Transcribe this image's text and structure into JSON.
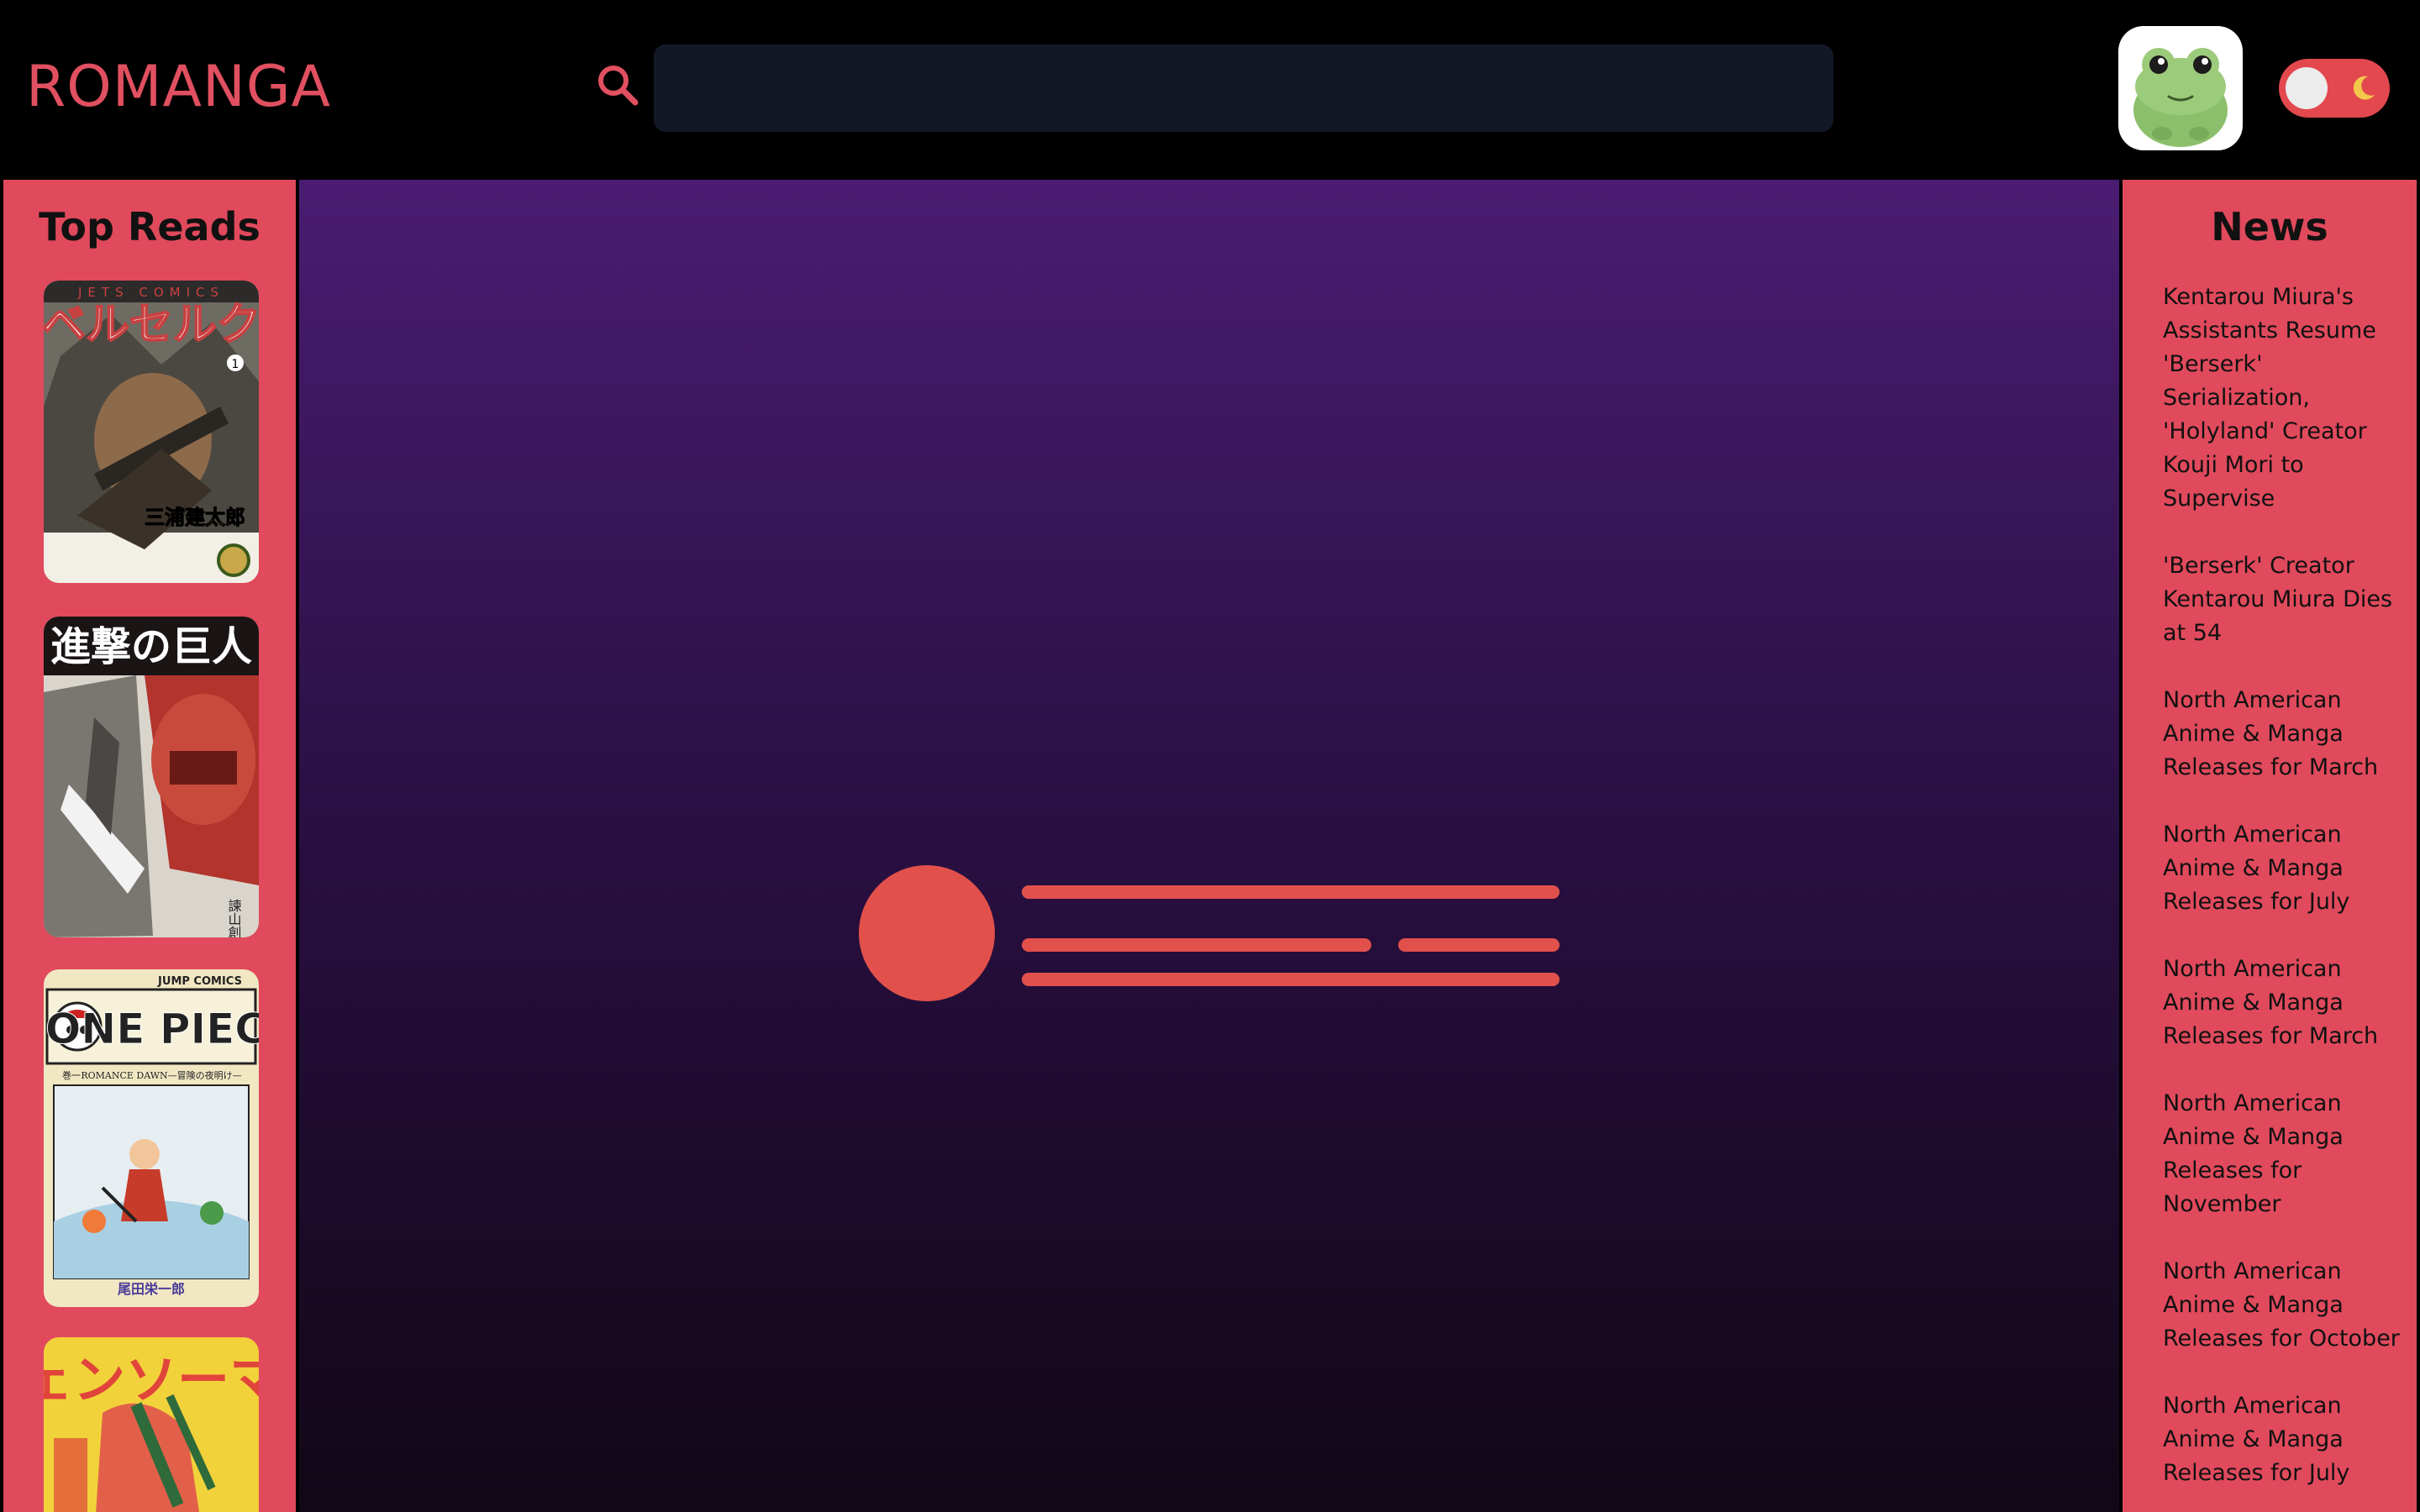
{
  "header": {
    "logo": "ROMANGA",
    "search": {
      "placeholder": "",
      "value": ""
    },
    "avatar_icon": "frog-avatar-icon",
    "theme_toggle_icon": "moon-icon"
  },
  "colors": {
    "accent": "#e04a5c",
    "search_bg": "#121826",
    "main_gradient_top": "#4a1c72",
    "main_gradient_bottom": "#110716"
  },
  "sidebar_left": {
    "title": "Top Reads",
    "covers": [
      {
        "name": "berserk-cover",
        "title_jp": "ベルセルク",
        "publisher": "JETS COMICS",
        "author_jp": "三浦建太郎",
        "volume": "1"
      },
      {
        "name": "attack-on-titan-cover",
        "title_jp": "進撃の巨人",
        "author_jp": "諫山創"
      },
      {
        "name": "one-piece-cover",
        "title": "ONE PIECE",
        "publisher": "JUMP COMICS",
        "subtitle": "ROMANCE DAWN—冒険の夜明け—",
        "author_jp": "尾田栄一郎",
        "volume_label": "巻一"
      },
      {
        "name": "chainsaw-man-cover",
        "title_jp": "チェンソーマン"
      }
    ]
  },
  "sidebar_right": {
    "title": "News",
    "items": [
      "Kentarou Miura's Assistants Resume 'Berserk' Serialization, 'Holyland' Creator Kouji Mori to Supervise",
      "'Berserk' Creator Kentarou Miura Dies at 54",
      "North American Anime & Manga Releases for March",
      "North American Anime & Manga Releases for July",
      "North American Anime & Manga Releases for March",
      "North American Anime & Manga Releases for November",
      "North American Anime & Manga Releases for October",
      "North American Anime & Manga Releases for July"
    ]
  }
}
